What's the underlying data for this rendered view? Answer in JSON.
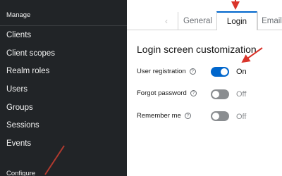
{
  "sidebar": {
    "manage_label": "Manage",
    "configure_label": "Configure",
    "items": [
      {
        "label": "Clients"
      },
      {
        "label": "Client scopes"
      },
      {
        "label": "Realm roles"
      },
      {
        "label": "Users"
      },
      {
        "label": "Groups"
      },
      {
        "label": "Sessions"
      },
      {
        "label": "Events"
      }
    ]
  },
  "tabs": {
    "prev_icon": "‹",
    "items": [
      {
        "label": "General"
      },
      {
        "label": "Login"
      },
      {
        "label": "Email"
      }
    ],
    "active": "Login"
  },
  "login": {
    "section_title": "Login screen customization",
    "help_glyph": "?",
    "settings": [
      {
        "label": "User registration",
        "state": "On",
        "enabled": true
      },
      {
        "label": "Forgot password",
        "state": "Off",
        "enabled": false
      },
      {
        "label": "Remember me",
        "state": "Off",
        "enabled": false
      }
    ]
  },
  "colors": {
    "sidebar_bg": "#212427",
    "accent": "#06c",
    "annotation_arrow": "#d9342b"
  },
  "icons": [
    "chevron-left-icon",
    "help-icon",
    "annotation-arrow"
  ]
}
